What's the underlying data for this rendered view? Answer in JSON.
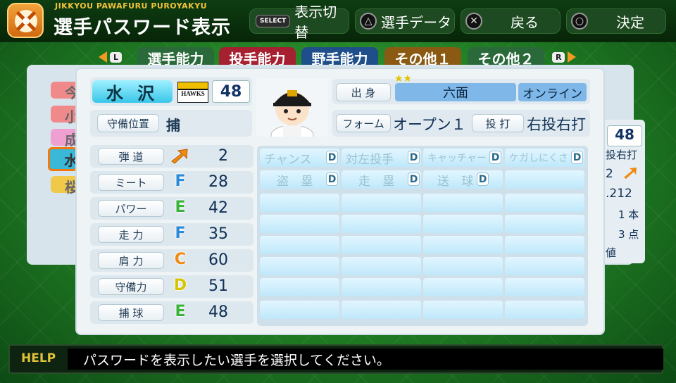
{
  "header": {
    "subtitle": "JIKKYOU PAWAFURU PUROYAKYU",
    "title": "選手パスワード表示",
    "select_key": "SELECT",
    "toggle_label": "表示切替",
    "triangle_label": "選手データ",
    "cross_label": "戻る",
    "circle_label": "決定"
  },
  "tabs": [
    {
      "label": "選手能力",
      "color": "#2a6a3a",
      "active": true
    },
    {
      "label": "投手能力",
      "color": "#a52030"
    },
    {
      "label": "野手能力",
      "color": "#1f4f8a"
    },
    {
      "label": "その他１",
      "color": "#8a5a12"
    },
    {
      "label": "その他２",
      "color": "#2a6a3a"
    }
  ],
  "shoulder": {
    "left": "L",
    "right": "R"
  },
  "player": {
    "name": "水 沢",
    "team_logo_text": "HAWKS",
    "number": "48",
    "position_label": "守備位置",
    "position": "捕",
    "birthplace_label": "出 身",
    "birthplace": "六面",
    "online": "オンライン",
    "form_label": "フォーム",
    "form": "オープン１",
    "throw_bat_label": "投 打",
    "throw_bat": "右投右打",
    "stars": "★★"
  },
  "stats": [
    {
      "label": "弾 道",
      "grade": "↗",
      "value": "2",
      "grade_color": "#f08a10"
    },
    {
      "label": "ミート",
      "grade": "F",
      "value": "28",
      "grade_color": "#2a8ad8"
    },
    {
      "label": "パワー",
      "grade": "E",
      "value": "42",
      "grade_color": "#3bb33b"
    },
    {
      "label": "走 力",
      "grade": "F",
      "value": "35",
      "grade_color": "#2a8ad8"
    },
    {
      "label": "肩 力",
      "grade": "C",
      "value": "60",
      "grade_color": "#f08a10"
    },
    {
      "label": "守備力",
      "grade": "D",
      "value": "51",
      "grade_color": "#d8c400"
    },
    {
      "label": "捕 球",
      "grade": "E",
      "value": "48",
      "grade_color": "#3bb33b"
    }
  ],
  "abilities": [
    {
      "label": "チャンス",
      "grade": "D"
    },
    {
      "label": "対左投手",
      "grade": "D"
    },
    {
      "label": "キャッチャー",
      "grade": "D"
    },
    {
      "label": "ケガしにくさ",
      "grade": "D"
    },
    {
      "label": "盗 塁",
      "grade": "D"
    },
    {
      "label": "走 塁",
      "grade": "D"
    },
    {
      "label": "送 球",
      "grade": "D"
    }
  ],
  "right_card": {
    "number": "48",
    "throw": "投右打",
    "ballistic": "2",
    "avg": ".212",
    "hr": "1 本",
    "rbi": "3 点",
    "misc": "値"
  },
  "background_tabs": [
    "今",
    "小",
    "成",
    "水",
    "桜"
  ],
  "help": {
    "label": "HELP",
    "text": "パスワードを表示したい選手を選択してください。"
  }
}
